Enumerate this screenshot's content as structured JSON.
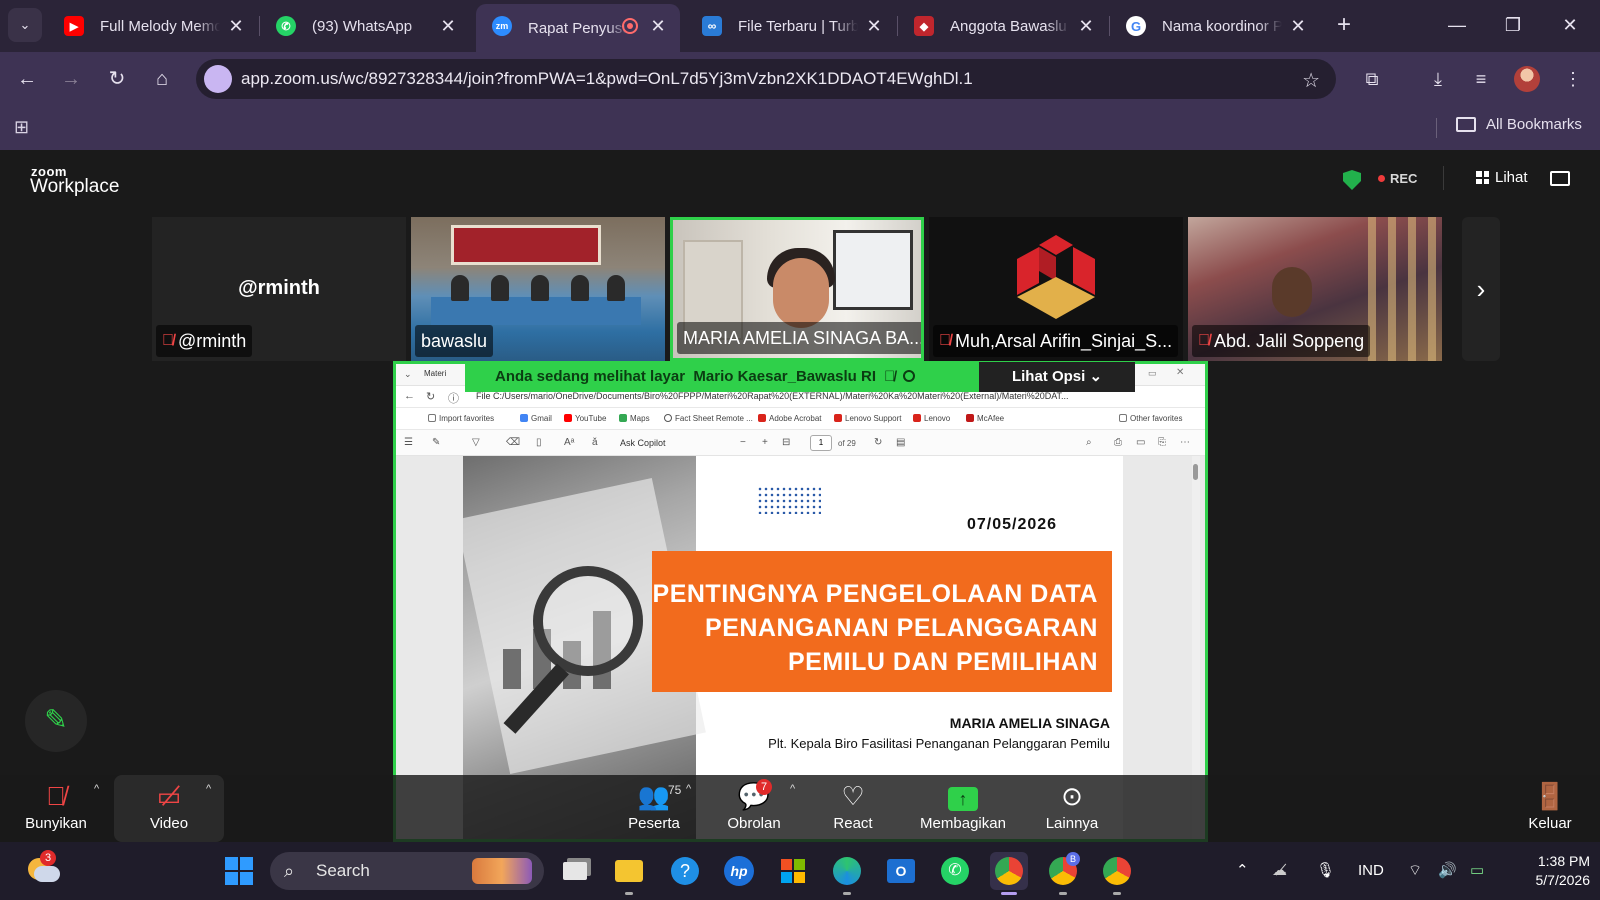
{
  "browser": {
    "tabs": [
      {
        "title": "Full Melody Memo",
        "favicon": "youtube-icon",
        "color": "#ff0000"
      },
      {
        "title": "(93) WhatsApp",
        "favicon": "whatsapp-icon",
        "color": "#25d366"
      },
      {
        "title": "Rapat Penyusu",
        "favicon": "zoom-icon",
        "color": "#2d8cff",
        "active": true
      },
      {
        "title": "File Terbaru | Turbo",
        "favicon": "turbo-icon",
        "color": "#2a7bd6"
      },
      {
        "title": "Anggota Bawaslu S",
        "favicon": "bawaslu-icon",
        "color": "#c0262d"
      },
      {
        "title": "Nama koordinor P",
        "favicon": "google-icon",
        "color": "#ffffff"
      }
    ],
    "url": "app.zoom.us/wc/8927328344/join?fromPWA=1&pwd=OnL7d5Yj3mVzbn2XK1DDAOT4EWghDl.1",
    "bookmarks_all": "All Bookmarks"
  },
  "zoom": {
    "logo_small": "zoom",
    "logo_big": "Workplace",
    "rec_label": "REC",
    "view_label": "Lihat",
    "participants": [
      {
        "name": "@rminth",
        "center_name": "@rminth",
        "muted": true,
        "video": "none"
      },
      {
        "name": "bawaslu",
        "muted": false,
        "video": "room"
      },
      {
        "name": "MARIA AMELIA SINAGA BA...",
        "muted": false,
        "video": "office",
        "speaking": true
      },
      {
        "name": "Muh,Arsal Arifin_Sinjai_S...",
        "muted": true,
        "video": "logo"
      },
      {
        "name": "Abd. Jalil Soppeng",
        "muted": true,
        "video": "poster"
      }
    ],
    "share": {
      "banner_prefix": "Anda sedang melihat layar",
      "presenter": "Mario Kaesar_Bawaslu RI",
      "options_label": "Lihat Opsi"
    },
    "controls": {
      "unmute": "Bunyikan",
      "video": "Video",
      "participants": "Peserta",
      "participants_count": "75",
      "chat": "Obrolan",
      "chat_badge": "7",
      "react": "React",
      "share": "Membagikan",
      "more": "Lainnya",
      "leave": "Keluar"
    }
  },
  "shared_screen": {
    "edge_tab": "Materi",
    "file_url": "File   C:/Users/mario/OneDrive/Documents/Biro%20FPPP/Materi%20Rapat%20(EXTERNAL)/Materi%20Ka%20Materi%20(External)/Materi%20DAT...",
    "favorites": [
      "Import favorites",
      "Gmail",
      "YouTube",
      "Maps",
      "Fact Sheet Remote ...",
      "Adobe Acrobat",
      "Lenovo Support",
      "Lenovo",
      "McAfee",
      "Other favorites"
    ],
    "copilot": "Ask Copilot",
    "page_current": "1",
    "page_total": "of 29",
    "slide": {
      "date": "07/05/2026",
      "title_lines": [
        "PENTINGNYA PENGELOLAAN DATA",
        "PENANGANAN PELANGGARAN",
        "PEMILU DAN PEMILIHAN"
      ],
      "presenter_name": "MARIA AMELIA SINAGA",
      "presenter_role": "Plt. Kepala Biro Fasilitasi Penanganan Pelanggaran Pemilu"
    }
  },
  "taskbar": {
    "weather_badge": "3",
    "search_label": "Search",
    "lang": "IND",
    "time": "1:38 PM",
    "date": "5/7/2026"
  }
}
